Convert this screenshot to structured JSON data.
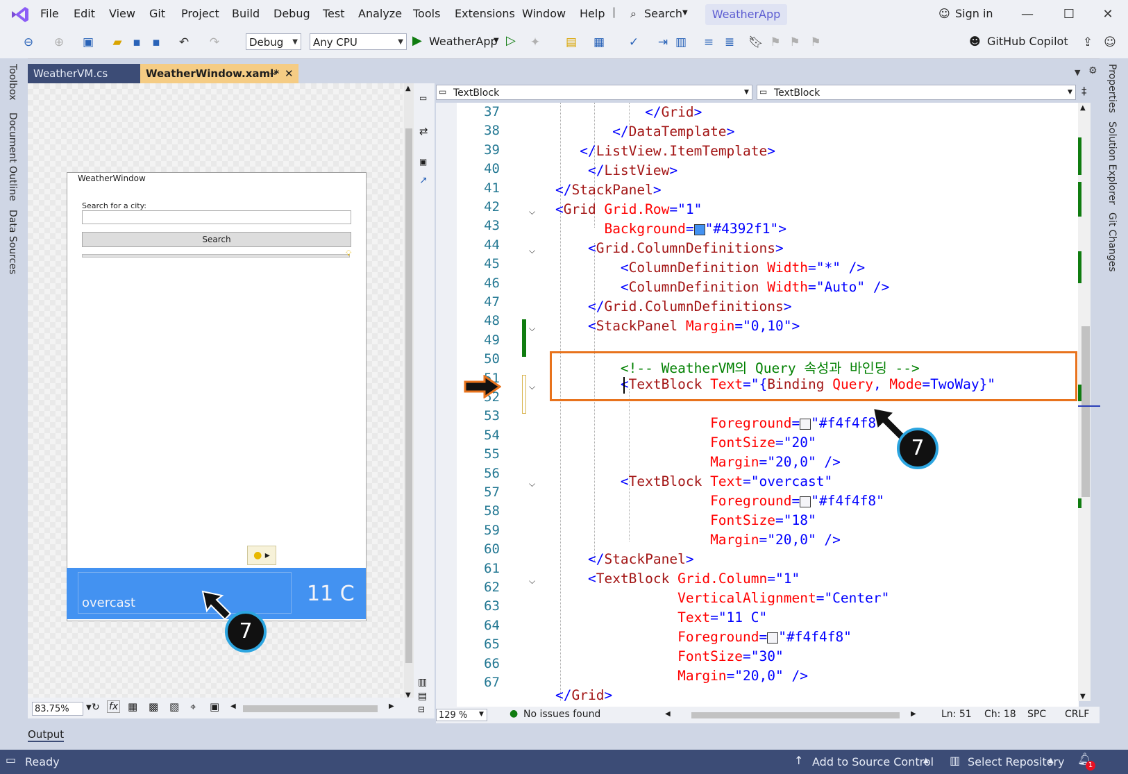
{
  "menu": {
    "items": [
      "File",
      "Edit",
      "View",
      "Git",
      "Project",
      "Build",
      "Debug",
      "Test",
      "Analyze",
      "Tools",
      "Extensions",
      "Window",
      "Help"
    ],
    "search_label": "Search",
    "app_name": "WeatherApp",
    "sign_in": "Sign in"
  },
  "toolbar": {
    "configuration": "Debug",
    "platform": "Any CPU",
    "run_target": "WeatherApp",
    "copilot": "GitHub Copilot"
  },
  "left_strip": [
    "Toolbox",
    "Document Outline",
    "Data Sources"
  ],
  "right_strip": [
    "Properties",
    "Solution Explorer",
    "Git Changes"
  ],
  "tabs": [
    {
      "label": "WeatherVM.cs"
    },
    {
      "label": "WeatherWindow.xaml*"
    }
  ],
  "designer": {
    "window_title": "WeatherWindow",
    "search_label": "Search for a city:",
    "search_button": "Search",
    "overcast": "overcast",
    "temperature": "11 C",
    "zoom": "83.75%",
    "callout": "7"
  },
  "editor": {
    "nav_left": "TextBlock",
    "nav_right": "TextBlock",
    "zoom": "129 %",
    "issues": "No issues found",
    "line": "Ln: 51",
    "col": "Ch: 18",
    "spc": "SPC",
    "eol": "CRLF",
    "callout": "7",
    "line_numbers": [
      "37",
      "38",
      "39",
      "40",
      "41",
      "42",
      "43",
      "44",
      "45",
      "46",
      "47",
      "48",
      "49",
      "50",
      "51",
      "52",
      "53",
      "54",
      "55",
      "56",
      "57",
      "58",
      "59",
      "60",
      "61",
      "62",
      "63",
      "64",
      "65",
      "66",
      "67"
    ]
  },
  "output_label": "Output",
  "status": {
    "ready": "Ready",
    "source_control": "Add to Source Control",
    "repository": "Select Repository",
    "notifications": "1"
  },
  "colors": {
    "accent": "#4392f1",
    "highlight_box": "#e8731d",
    "status_bar": "#3c4c76",
    "callout_ring": "#2ca5e0"
  }
}
